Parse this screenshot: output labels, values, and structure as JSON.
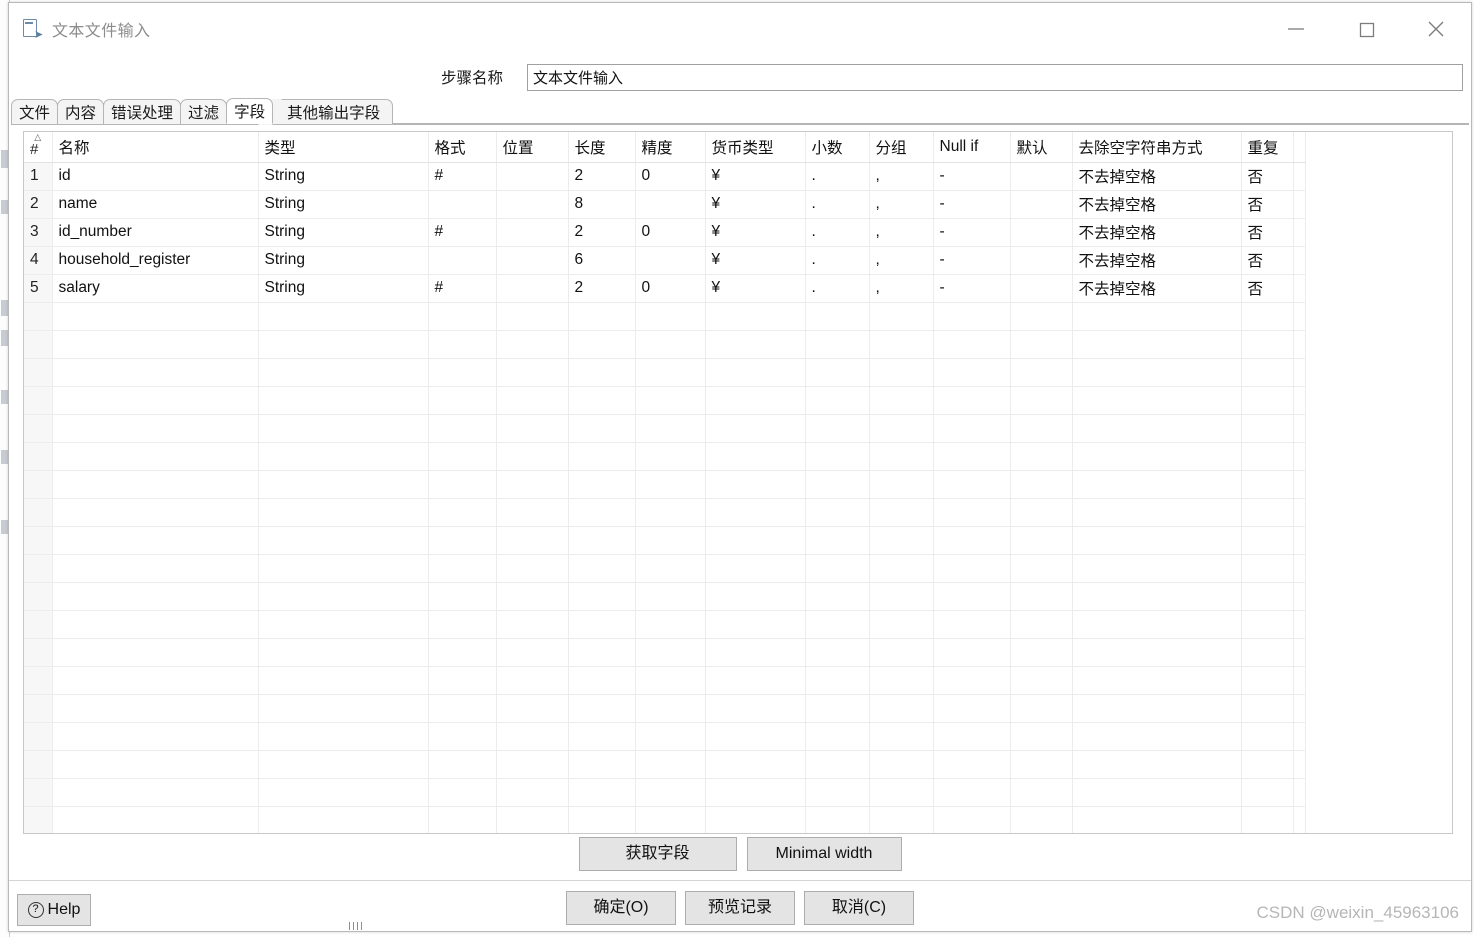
{
  "window": {
    "title": "文本文件输入",
    "icon": "file-input-icon",
    "controls": {
      "minimize": "minimize-icon",
      "maximize": "maximize-icon",
      "close": "close-icon"
    }
  },
  "step": {
    "label": "步骤名称",
    "value": "文本文件输入",
    "placeholder": ""
  },
  "tabs": [
    {
      "label": "文件",
      "name": "tab-file",
      "active": false
    },
    {
      "label": "内容",
      "name": "tab-content",
      "active": false
    },
    {
      "label": "错误处理",
      "name": "tab-error-handling",
      "active": false
    },
    {
      "label": "过滤",
      "name": "tab-filter",
      "active": false
    },
    {
      "label": "字段",
      "name": "tab-fields",
      "active": true
    },
    {
      "label": "其他输出字段",
      "name": "tab-extra-output-fields",
      "active": false
    }
  ],
  "table": {
    "columns": [
      "#",
      "名称",
      "类型",
      "格式",
      "位置",
      "长度",
      "精度",
      "货币类型",
      "小数",
      "分组",
      "Null if",
      "默认",
      "去除空字符串方式",
      "重复",
      ""
    ],
    "sort_indicator": "caret-up-icon",
    "rows": [
      {
        "index": "1",
        "名称": "id",
        "类型": "String",
        "格式": "#",
        "位置": "",
        "长度": "2",
        "精度": "0",
        "货币类型": "¥",
        "小数": ".",
        "分组": ",",
        "Null if": "-",
        "默认": "",
        "去除空字符串方式": "不去掉空格",
        "重复": "否",
        "extra": ""
      },
      {
        "index": "2",
        "名称": "name",
        "类型": "String",
        "格式": "",
        "位置": "",
        "长度": "8",
        "精度": "",
        "货币类型": "¥",
        "小数": ".",
        "分组": ",",
        "Null if": "-",
        "默认": "",
        "去除空字符串方式": "不去掉空格",
        "重复": "否",
        "extra": ""
      },
      {
        "index": "3",
        "名称": "id_number",
        "类型": "String",
        "格式": "#",
        "位置": "",
        "长度": "2",
        "精度": "0",
        "货币类型": "¥",
        "小数": ".",
        "分组": ",",
        "Null if": "-",
        "默认": "",
        "去除空字符串方式": "不去掉空格",
        "重复": "否",
        "extra": ""
      },
      {
        "index": "4",
        "名称": "household_register",
        "类型": "String",
        "格式": "",
        "位置": "",
        "长度": "6",
        "精度": "",
        "货币类型": "¥",
        "小数": ".",
        "分组": ",",
        "Null if": "-",
        "默认": "",
        "去除空字符串方式": "不去掉空格",
        "重复": "否",
        "extra": ""
      },
      {
        "index": "5",
        "名称": "salary",
        "类型": "String",
        "格式": "#",
        "位置": "",
        "长度": "2",
        "精度": "0",
        "货币类型": "¥",
        "小数": ".",
        "分组": ",",
        "Null if": "-",
        "默认": "",
        "去除空字符串方式": "不去掉空格",
        "重复": "否",
        "extra": ""
      }
    ],
    "empty_row_count": 19
  },
  "mid_buttons": {
    "get_fields": "获取字段",
    "minimal_width": "Minimal width"
  },
  "footer": {
    "help": "Help",
    "help_icon": "question-circle-icon",
    "ok": "确定(O)",
    "preview": "预览记录",
    "cancel": "取消(C)"
  },
  "watermark": "CSDN @weixin_45963106",
  "colors": {
    "dialog_bg": "#ffffff",
    "button_face": "#e4e4e4",
    "button_border": "#adadad",
    "grid_line": "#ececec",
    "index_col_bg": "#f7f7f7",
    "tab_inactive_bg": "#f4f4f4",
    "title_text": "#8c8c8c",
    "watermark": "#b6b6b6"
  }
}
